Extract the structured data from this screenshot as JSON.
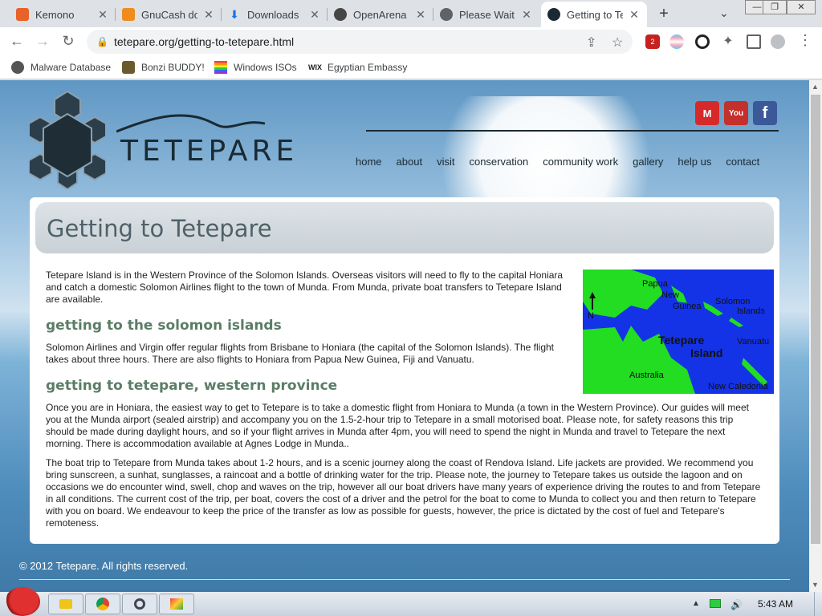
{
  "browser": {
    "tabs": [
      {
        "title": "Kemono",
        "color": "#e8622a"
      },
      {
        "title": "GnuCash do",
        "color": "#f08b1d"
      },
      {
        "title": "Downloads",
        "color": "#1a73e8"
      },
      {
        "title": "OpenArena E",
        "color": "#464646"
      },
      {
        "title": "Please Wait",
        "color": "#5f6368"
      },
      {
        "title": "Getting to Te",
        "color": "#1a2a33"
      }
    ],
    "new_tab": "+",
    "tab_menu": "⌄",
    "url": "tetepare.org/getting-to-tetepare.html",
    "extension_badge": "2",
    "bookmarks": [
      {
        "label": "Malware Database",
        "color": "#444"
      },
      {
        "label": "Bonzi BUDDY!",
        "color": "#6a5b2e"
      },
      {
        "label": "Windows ISOs",
        "color": "#e44"
      },
      {
        "label": "Egyptian Embassy",
        "color": "#222"
      }
    ]
  },
  "site": {
    "wordmark": "TETEPARE",
    "social": [
      {
        "name": "email",
        "label": "M",
        "color": "#d62a2a"
      },
      {
        "name": "youtube",
        "label": "You",
        "color": "#c4302b"
      },
      {
        "name": "facebook",
        "label": "f",
        "color": "#3b5998"
      }
    ],
    "nav": [
      "home",
      "about",
      "visit",
      "conservation",
      "community work",
      "gallery",
      "help us",
      "contact"
    ],
    "page_title": "Getting to Tetepare",
    "intro": "Tetepare Island is in the Western Province of the Solomon Islands. Overseas visitors will need to fly to the capital Honiara and catch a domestic Solomon Airlines flight to the town of Munda. From Munda, private boat transfers to Tetepare Island are available.",
    "section1_heading": "getting to the solomon islands",
    "section1_text": "Solomon Airlines and Virgin offer regular flights from Brisbane to Honiara (the capital of the Solomon Islands). The flight takes about three hours. There are also flights to Honiara from Papua New Guinea, Fiji and Vanuatu.",
    "section2_heading": "getting to tetepare, western province",
    "section2_text": "Once you are in Honiara, the easiest way to get to Tetepare is to take a domestic flight from Honiara to Munda (a town in the Western Province). Our guides will meet you at the Munda airport (sealed airstrip) and accompany you on the 1.5-2-hour trip to Tetepare in a small motorised boat. Please note, for safety reasons this trip should be made during daylight hours, and so if your flight arrives in Munda after 4pm, you will need to spend the night in Munda and travel to Tetepare the next morning. There is accommodation available at Agnes Lodge in Munda..",
    "section3_text": "The boat trip to Tetepare from Munda takes about 1-2 hours, and is a scenic journey along the coast of Rendova Island. Life jackets are provided. We recommend you bring sunscreen, a sunhat, sunglasses, a raincoat and a bottle of drinking water for the trip. Please note, the journey to Tetepare takes us outside the lagoon and on occasions we do encounter wind, swell, chop and waves on the trip, however all our boat drivers have many years of experience driving the routes to and from Tetepare in all conditions. The current cost of the trip, per boat, covers the cost of a driver and the petrol for the boat to come to Munda to collect you and then return to Tetepare with you on board. We endeavour to keep the price of the transfer as low as possible for guests, however, the price is dictated by the cost of fuel and Tetepare's remoteness.",
    "map_labels": {
      "papua": "Papua",
      "new": "New",
      "guinea": "Guinea",
      "solomon": "Solomon",
      "islands": "Islands",
      "tetepare": "Tetepare",
      "island": "Island",
      "vanuatu": "Vanuatu",
      "australia": "Australia",
      "new_caledonia": "New Caledonia",
      "north": "N"
    },
    "footer": "© 2012 Tetepare. All rights reserved."
  },
  "taskbar": {
    "clock": "5:43 AM"
  }
}
